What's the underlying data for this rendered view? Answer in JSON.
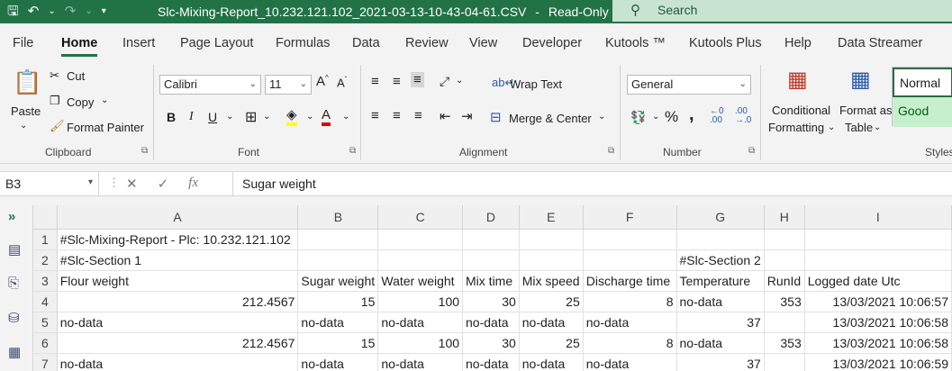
{
  "titlebar": {
    "filename": "Slc-Mixing-Report_10.232.121.102_2021-03-13-10-43-04-61.CSV",
    "separator": "-",
    "mode": "Read-Only",
    "search_placeholder": "Search"
  },
  "tabs": [
    "File",
    "Home",
    "Insert",
    "Page Layout",
    "Formulas",
    "Data",
    "Review",
    "View",
    "Developer",
    "Kutools ™",
    "Kutools Plus",
    "Help",
    "Data Streamer"
  ],
  "active_tab": "Home",
  "ribbon": {
    "clipboard": {
      "paste": "Paste",
      "cut": "Cut",
      "copy": "Copy",
      "format_painter": "Format Painter",
      "label": "Clipboard"
    },
    "font": {
      "family": "Calibri",
      "size": "11",
      "bold": "B",
      "italic": "I",
      "underline": "U",
      "label": "Font"
    },
    "alignment": {
      "wrap_text": "Wrap Text",
      "merge_center": "Merge & Center",
      "label": "Alignment"
    },
    "number": {
      "format": "General",
      "percent": "%",
      "comma": ",",
      "label": "Number"
    },
    "styles": {
      "conditional": "Conditional",
      "formatting": "Formatting",
      "format_as": "Format as",
      "table": "Table",
      "normal": "Normal",
      "good": "Good",
      "label": "Styles"
    }
  },
  "formula_bar": {
    "name_box": "B3",
    "content": "Sugar weight"
  },
  "grid": {
    "columns": [
      "A",
      "B",
      "C",
      "D",
      "E",
      "F",
      "G",
      "H",
      "I"
    ],
    "rows": [
      {
        "n": "1",
        "cells": [
          "#Slc-Mixing-Report - Plc: 10.232.121.102",
          "",
          "",
          "",
          "",
          "",
          "",
          "",
          ""
        ]
      },
      {
        "n": "2",
        "cells": [
          "#Slc-Section 1",
          "",
          "",
          "",
          "",
          "",
          "#Slc-Section 2",
          "",
          ""
        ]
      },
      {
        "n": "3",
        "cells": [
          "Flour weight",
          "Sugar weight",
          "Water weight",
          "Mix time",
          "Mix speed",
          "Discharge time",
          "Temperature",
          "RunId",
          "Logged date Utc"
        ]
      },
      {
        "n": "4",
        "cells": [
          "212.4567",
          "15",
          "100",
          "30",
          "25",
          "8",
          "no-data",
          "353",
          "13/03/2021 10:06:57"
        ]
      },
      {
        "n": "5",
        "cells": [
          "no-data",
          "no-data",
          "no-data",
          "no-data",
          "no-data",
          "no-data",
          "37",
          "",
          "13/03/2021 10:06:58"
        ]
      },
      {
        "n": "6",
        "cells": [
          "212.4567",
          "15",
          "100",
          "30",
          "25",
          "8",
          "no-data",
          "353",
          "13/03/2021 10:06:58"
        ]
      },
      {
        "n": "7",
        "cells": [
          "no-data",
          "no-data",
          "no-data",
          "no-data",
          "no-data",
          "no-data",
          "37",
          "",
          "13/03/2021 10:06:59"
        ]
      }
    ]
  }
}
